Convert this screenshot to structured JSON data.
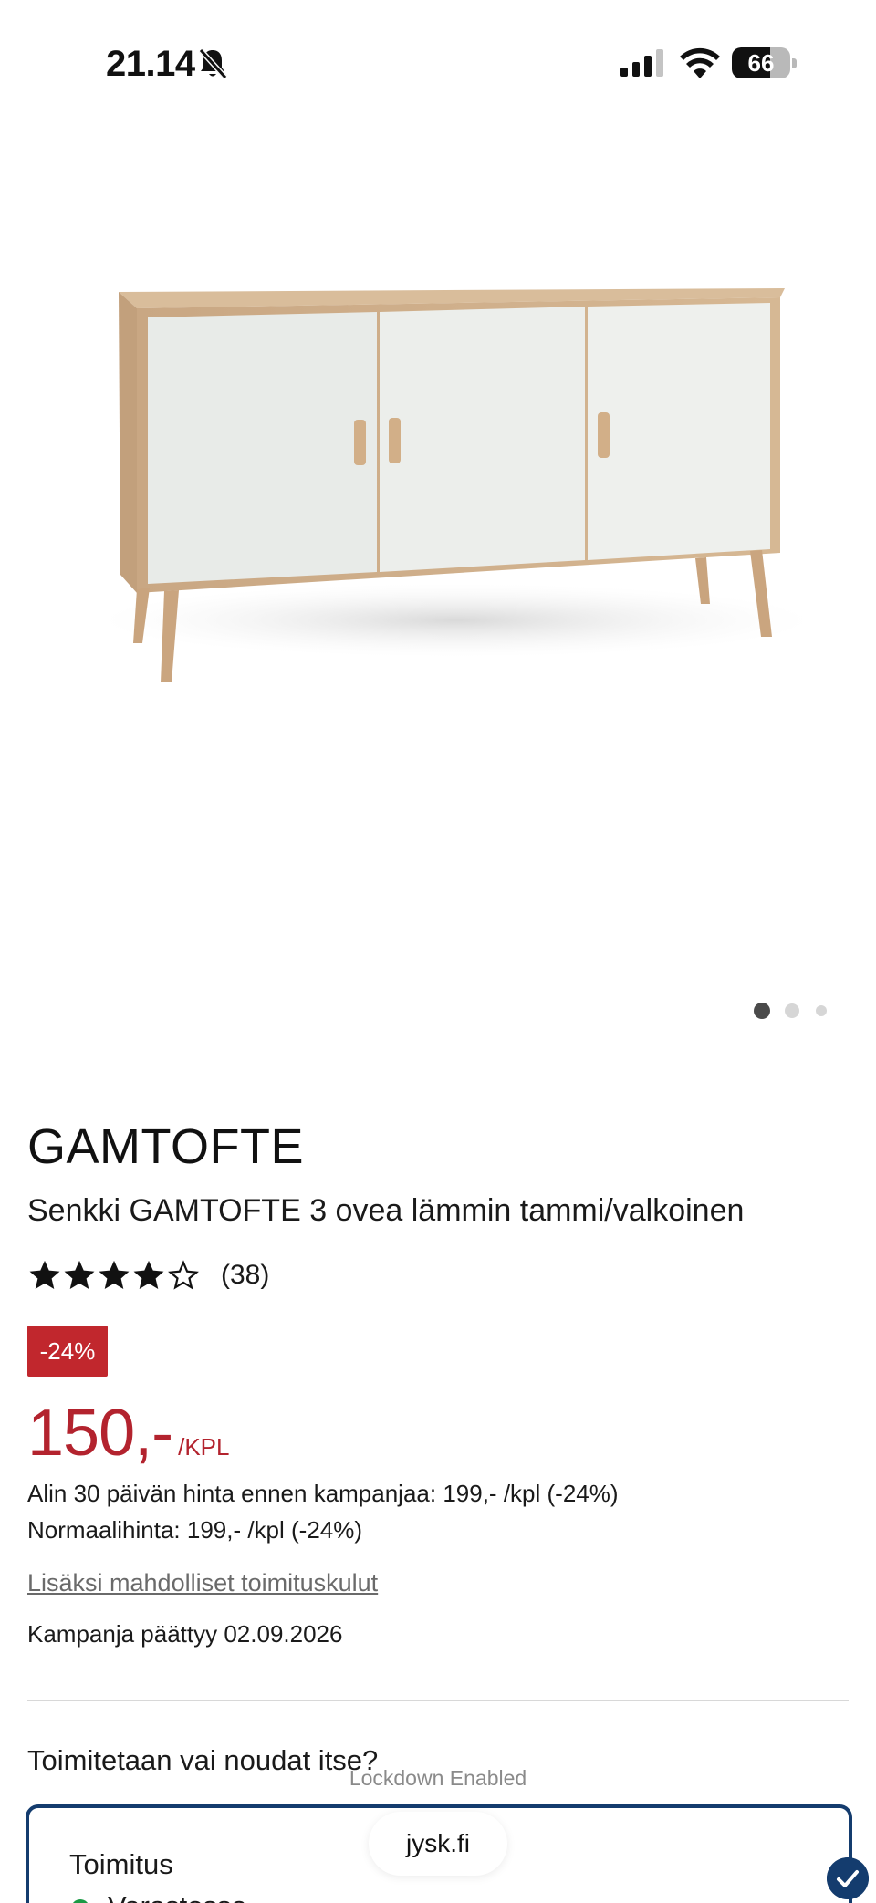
{
  "status_bar": {
    "time": "21.14",
    "battery": "66",
    "battery_level": 0.66,
    "icons": [
      "bell-slash-icon",
      "cellular-signal-icon",
      "wifi-icon",
      "battery-icon"
    ]
  },
  "gallery": {
    "image_icon": "sideboard-product-image",
    "current_slide": 1,
    "total_slides": 3
  },
  "product": {
    "brand": "GAMTOFTE",
    "name": "Senkki GAMTOFTE 3 ovea lämmin tammi/valkoinen",
    "rating": 4,
    "rating_max": 5,
    "review_count": "(38)"
  },
  "pricing": {
    "discount": "-24%",
    "price": "150,-",
    "unit": "/KPL",
    "note_30_days": "Alin 30 päivän hinta ennen kampanjaa: 199,- /kpl (-24%)",
    "note_normal": "Normaalihinta: 199,- /kpl (-24%)",
    "shipping_link": "Lisäksi mahdolliset toimituskulut",
    "campaign_end": "Kampanja päättyy 02.09.2026",
    "colors": {
      "sale_red": "#b3232e",
      "badge_red": "#c1272d"
    }
  },
  "delivery": {
    "heading": "Toimitetaan vai noudat itse?",
    "option_title": "Toimitus",
    "stock_status": "Varastossa",
    "colors": {
      "border": "#143c6e",
      "in_stock": "#1a9a45"
    }
  },
  "browser": {
    "lockdown_text": "Lockdown Enabled",
    "url": "jysk.fi"
  }
}
